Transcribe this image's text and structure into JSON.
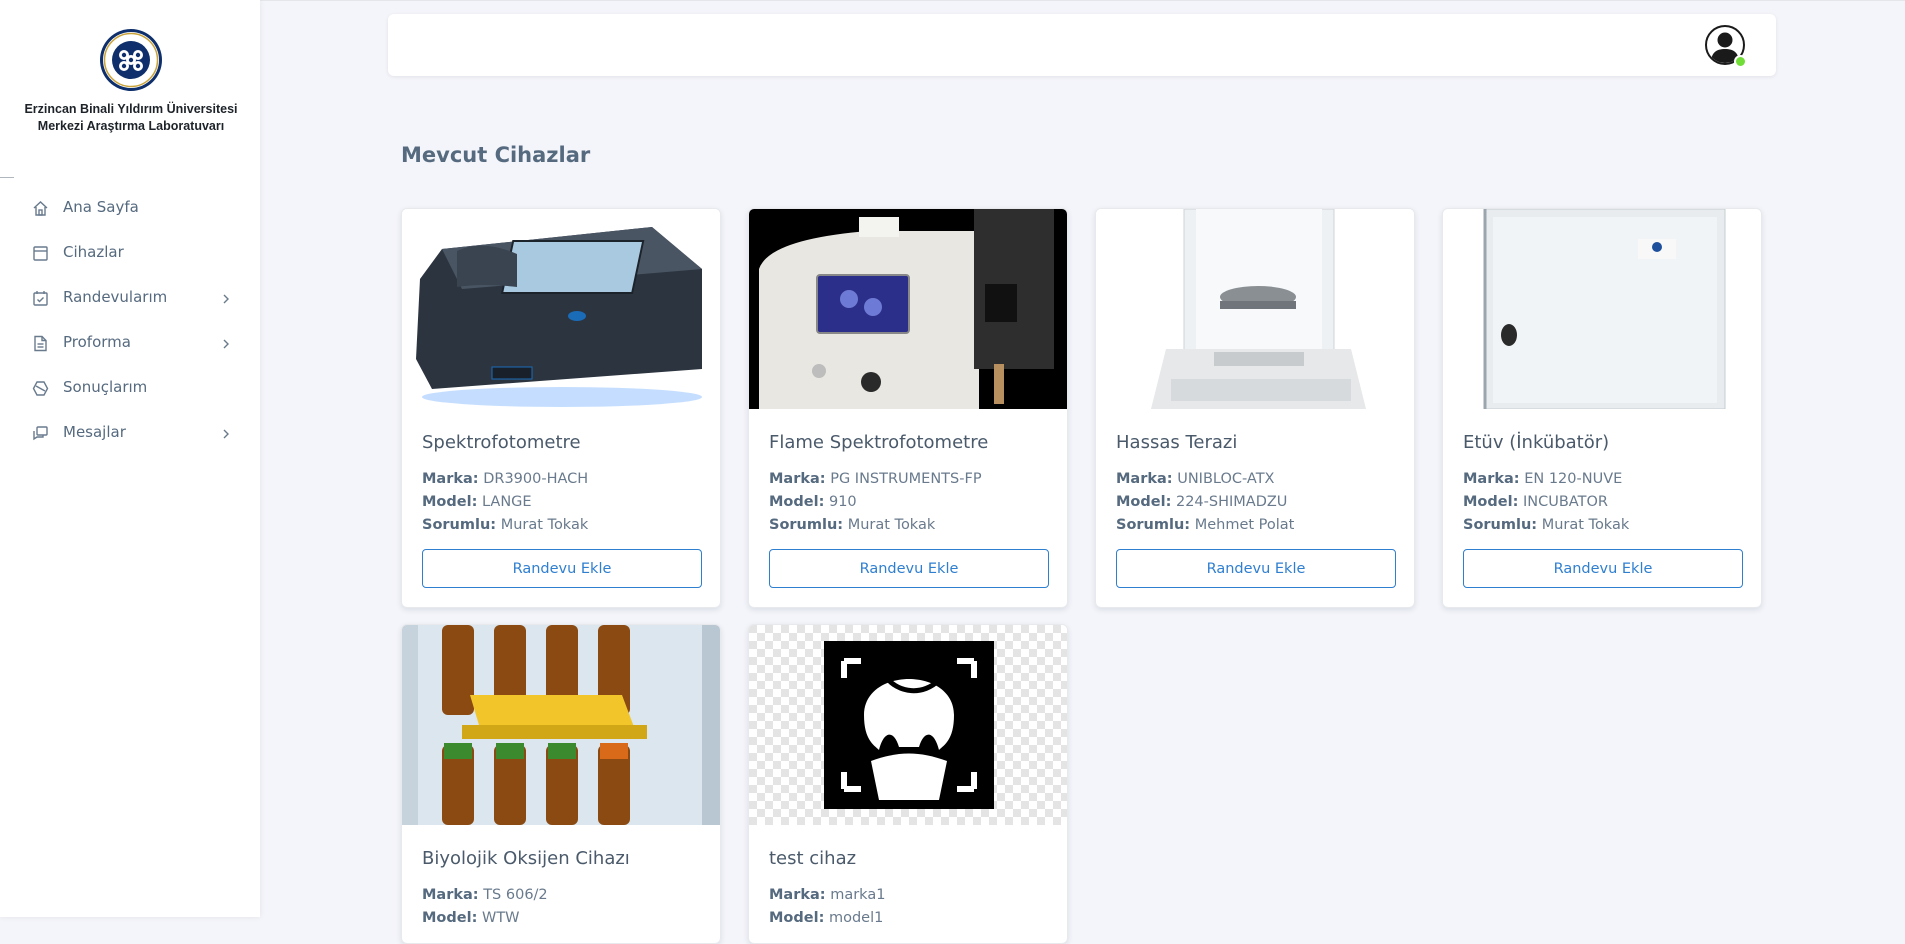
{
  "sidebar": {
    "institution": [
      "Erzincan Binali Yıldırım Üniversitesi",
      "Merkezi Araştırma Laboratuvarı"
    ],
    "items": [
      {
        "label": "Ana Sayfa",
        "icon": "home-icon",
        "has_submenu": false
      },
      {
        "label": "Cihazlar",
        "icon": "window-icon",
        "has_submenu": false
      },
      {
        "label": "Randevularım",
        "icon": "calendar-check-icon",
        "has_submenu": true
      },
      {
        "label": "Proforma",
        "icon": "document-icon",
        "has_submenu": true
      },
      {
        "label": "Sonuçlarım",
        "icon": "polygon-icon",
        "has_submenu": false
      },
      {
        "label": "Mesajlar",
        "icon": "chat-icon",
        "has_submenu": true
      }
    ]
  },
  "header": {
    "avatar_status_color": "#71dd37"
  },
  "main": {
    "title": "Mevcut Cihazlar",
    "labels": {
      "brand": "Marka:",
      "model": "Model:",
      "responsible": "Sorumlu:"
    },
    "button_label": "Randevu Ekle",
    "devices": [
      {
        "name": "Spektrofotometre",
        "brand": "DR3900-HACH",
        "model": "LANGE",
        "responsible": "Murat Tokak"
      },
      {
        "name": "Flame Spektrofotometre",
        "brand": "PG INSTRUMENTS-FP",
        "model": "910",
        "responsible": "Murat Tokak"
      },
      {
        "name": "Hassas Terazi",
        "brand": "UNIBLOC-ATX",
        "model": "224-SHIMADZU",
        "responsible": "Mehmet Polat"
      },
      {
        "name": "Etüv (İnkübatör)",
        "brand": "EN 120-NUVE",
        "model": "INCUBATOR",
        "responsible": "Murat Tokak"
      },
      {
        "name": "Biyolojik Oksijen Cihazı",
        "brand": "TS 606/2",
        "model": "WTW",
        "responsible": ""
      },
      {
        "name": "test cihaz",
        "brand": "marka1",
        "model": "model1",
        "responsible": ""
      }
    ]
  },
  "colors": {
    "accent": "#2f7fd0",
    "text": "#566a7f",
    "background": "#f4f5fa"
  }
}
